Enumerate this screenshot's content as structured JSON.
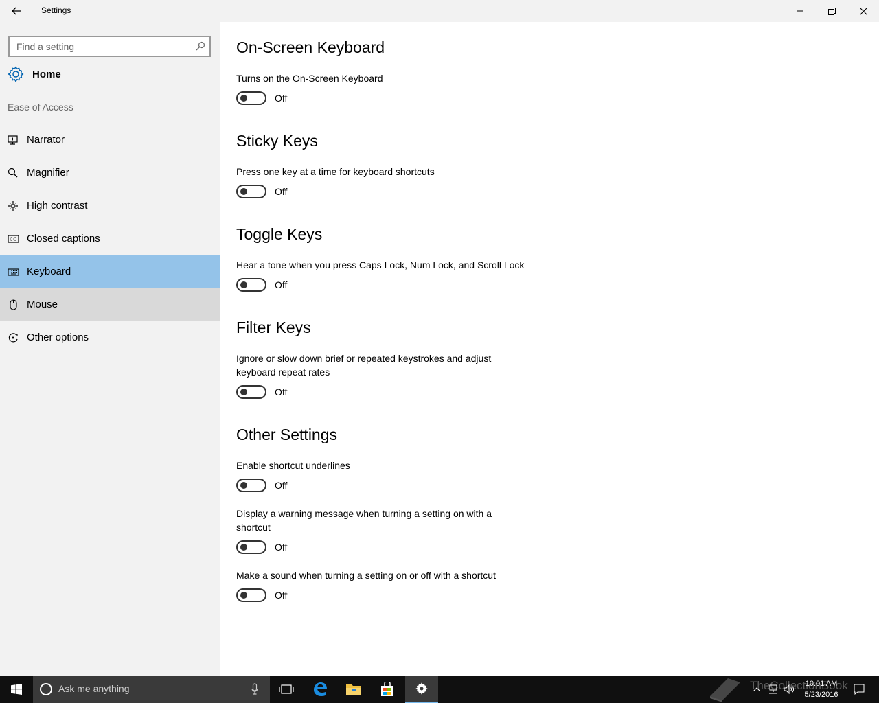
{
  "window": {
    "title": "Settings"
  },
  "sidebar": {
    "search_placeholder": "Find a setting",
    "home_label": "Home",
    "section_label": "Ease of Access",
    "items": [
      {
        "label": "Narrator",
        "icon": "narrator-icon"
      },
      {
        "label": "Magnifier",
        "icon": "magnifier-icon"
      },
      {
        "label": "High contrast",
        "icon": "high-contrast-icon"
      },
      {
        "label": "Closed captions",
        "icon": "closed-captions-icon"
      },
      {
        "label": "Keyboard",
        "icon": "keyboard-icon",
        "selected": true
      },
      {
        "label": "Mouse",
        "icon": "mouse-icon",
        "hover": true
      },
      {
        "label": "Other options",
        "icon": "other-options-icon"
      }
    ]
  },
  "content": {
    "sections": [
      {
        "heading": "On-Screen Keyboard",
        "settings": [
          {
            "description": "Turns on the On-Screen Keyboard",
            "state": "Off"
          }
        ]
      },
      {
        "heading": "Sticky Keys",
        "settings": [
          {
            "description": "Press one key at a time for keyboard shortcuts",
            "state": "Off"
          }
        ]
      },
      {
        "heading": "Toggle Keys",
        "settings": [
          {
            "description": "Hear a tone when you press Caps Lock, Num Lock, and Scroll Lock",
            "state": "Off"
          }
        ]
      },
      {
        "heading": "Filter Keys",
        "settings": [
          {
            "description": "Ignore or slow down brief or repeated keystrokes and adjust keyboard repeat rates",
            "state": "Off"
          }
        ]
      },
      {
        "heading": "Other Settings",
        "settings": [
          {
            "description": "Enable shortcut underlines",
            "state": "Off"
          },
          {
            "description": "Display a warning message when turning a setting on with a shortcut",
            "state": "Off"
          },
          {
            "description": "Make a sound when turning a setting on or off with a shortcut",
            "state": "Off"
          }
        ]
      }
    ]
  },
  "taskbar": {
    "search_placeholder": "Ask me anything",
    "time": "10:01 AM",
    "date": "5/23/2016",
    "watermark": "TheCollectionBook"
  },
  "colors": {
    "selected_item": "#94c3e9",
    "hover_item": "#d9d9d9",
    "sidebar_bg": "#f2f2f2",
    "content_bg": "#ffffff",
    "taskbar_bg": "#101010",
    "accent": "#76b9ed"
  }
}
